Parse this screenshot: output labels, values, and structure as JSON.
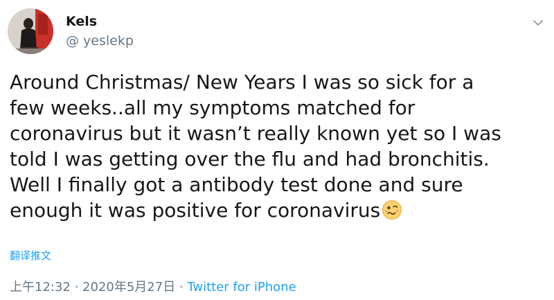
{
  "user": {
    "display_name": "Kels",
    "handle": "@ yeslekp"
  },
  "tweet": {
    "lines": [
      "Around Christmas/ New Years I was so sick for a",
      "few weeks..all my symptoms matched for",
      "coronavirus but it wasn’t really known yet so I was",
      "told I was getting over the flu and had bronchitis.",
      "Well I finally got a antibody test done and sure",
      "enough it was positive for coronavirus"
    ],
    "emoji": "woozy-face-icon"
  },
  "translate_label": "翻译推文",
  "meta": {
    "timestamp": "上午12:32 · 2020年5月27日",
    "separator": " · ",
    "source": "Twitter for iPhone"
  },
  "colors": {
    "link": "#1da1f2",
    "secondary": "#657786",
    "text": "#14171a"
  }
}
